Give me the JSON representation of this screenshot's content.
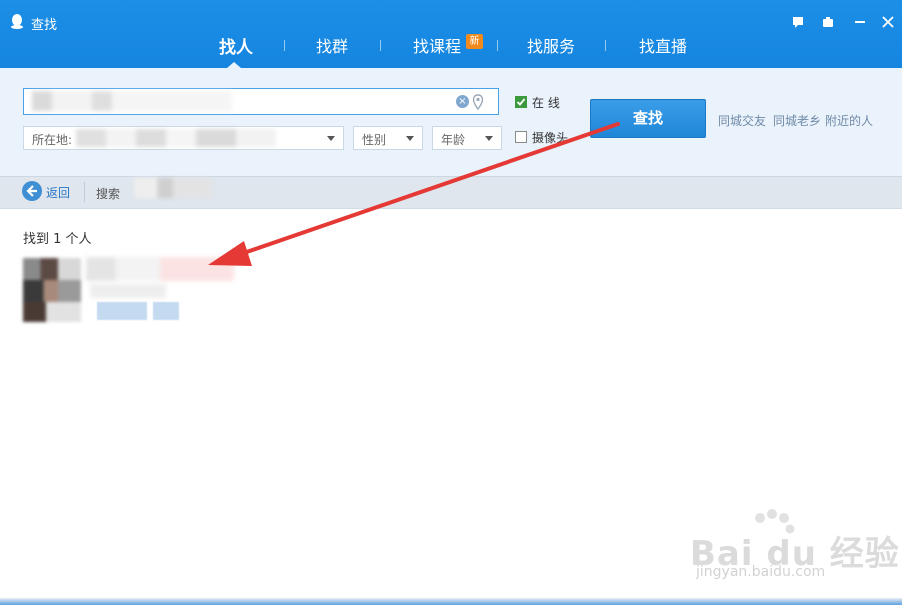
{
  "window": {
    "title": "查找"
  },
  "title_buttons": [
    "help-icon",
    "skin-icon",
    "minimize-icon",
    "close-icon"
  ],
  "tabs": [
    {
      "label": "找人",
      "active": true
    },
    {
      "label": "找群"
    },
    {
      "label": "找课程",
      "badge": "新"
    },
    {
      "label": "找服务"
    },
    {
      "label": "找直播"
    }
  ],
  "search": {
    "location_label": "所在地:",
    "gender_placeholder": "性别",
    "age_placeholder": "年龄",
    "online_label": "在  线",
    "camera_label": "摄像头",
    "online_checked": true,
    "camera_checked": false,
    "find_button": "查找",
    "quick_links": [
      "同城交友",
      "同城老乡",
      "附近的人"
    ]
  },
  "nav": {
    "back_label": "返回",
    "crumb_label": "搜索"
  },
  "results": {
    "count_text": "找到 1 个人"
  },
  "watermark": {
    "main": "Bai du 经验",
    "sub": "jingyan.baidu.com"
  },
  "colors": {
    "titlebar": "#1585e0",
    "accent": "#2a8fe0",
    "arrow": "#e53935",
    "badge": "#f08a1c"
  }
}
